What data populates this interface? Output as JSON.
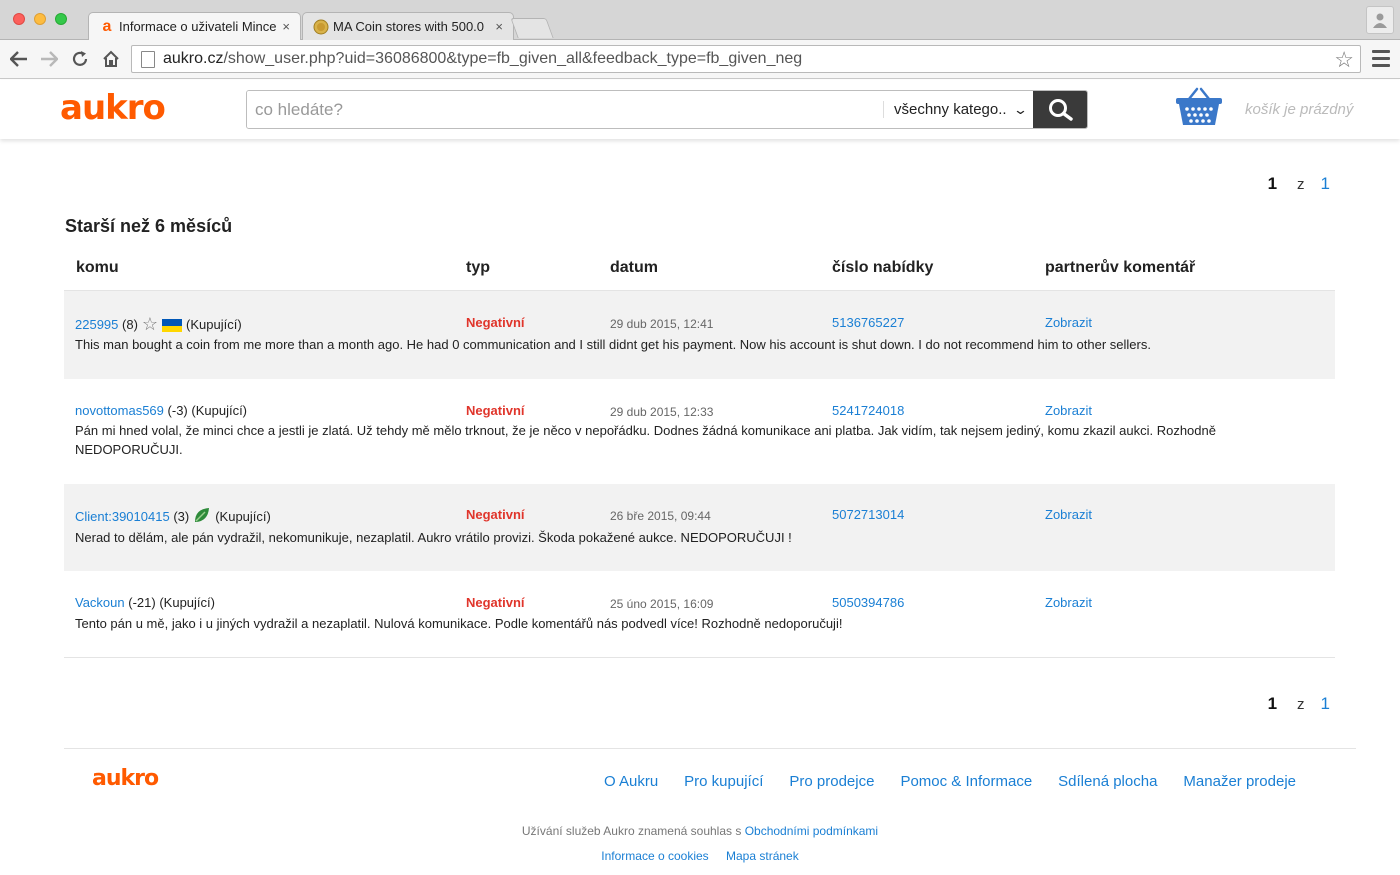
{
  "browser": {
    "tabs": [
      {
        "favicon": "a",
        "title": "Informace o uživateli Mince",
        "close": "×",
        "active": true
      },
      {
        "favicon": "coin",
        "title": "MA Coin stores with 500.0",
        "close": "×",
        "active": false
      }
    ],
    "url_host": "aukro.cz",
    "url_path": "/show_user.php?uid=36086800&type=fb_given_all&feedback_type=fb_given_neg",
    "icons": {
      "back": "back-arrow-icon",
      "forward": "forward-arrow-icon",
      "reload": "reload-icon",
      "home": "home-icon",
      "bookmark": "star-icon",
      "menu": "hamburger-menu-icon",
      "profile": "person-icon"
    }
  },
  "header": {
    "logo": "aukro",
    "search_placeholder": "co hledáte?",
    "category": "všechny katego..",
    "basket_text": "košík je prázdný"
  },
  "pager_top": {
    "current": "1",
    "of": "z",
    "total": "1"
  },
  "section": {
    "title": "Starší než 6 měsíců",
    "columns": {
      "komu": "komu",
      "typ": "typ",
      "datum": "datum",
      "offer": "číslo nabídky",
      "comment": "partnerův komentář"
    }
  },
  "rows": [
    {
      "user": "225995",
      "score": "(8)",
      "badge": "star",
      "flag": "ukraine",
      "role": "(Kupující)",
      "type": "Negativní",
      "date": "29 dub 2015, 12:41",
      "offer": "5136765227",
      "comment_link": "Zobrazit",
      "text": "This man bought a coin from me more than a month ago. He had 0 communication and I still didnt get his payment. Now his account is shut down. I do not recommend him to other sellers."
    },
    {
      "user": "novottomas569",
      "score": "(-3)",
      "badge": "",
      "flag": "",
      "role": "(Kupující)",
      "type": "Negativní",
      "date": "29 dub 2015, 12:33",
      "offer": "5241724018",
      "comment_link": "Zobrazit",
      "text": "Pán mi hned volal, že minci chce a jestli je zlatá. Už tehdy mě mělo trknout, že je něco v nepořádku. Dodnes žádná komunikace ani platba. Jak vidím, tak nejsem jediný, komu zkazil aukci. Rozhodně NEDOPORUČUJI."
    },
    {
      "user": "Client:39010415",
      "score": "(3)",
      "badge": "leaf",
      "flag": "",
      "role": "(Kupující)",
      "type": "Negativní",
      "date": "26 bře 2015, 09:44",
      "offer": "5072713014",
      "comment_link": "Zobrazit",
      "text": "Nerad to dělám, ale pán vydražil, nekomunikuje, nezaplatil. Aukro vrátilo provizi. Škoda pokažené aukce. NEDOPORUČUJI !"
    },
    {
      "user": "Vackoun",
      "score": "(-21)",
      "badge": "",
      "flag": "",
      "role": "(Kupující)",
      "type": "Negativní",
      "date": "25 úno 2015, 16:09",
      "offer": "5050394786",
      "comment_link": "Zobrazit",
      "text": "Tento pán u mě, jako i u jiných vydražil a nezaplatil. Nulová komunikace. Podle komentářů nás podvedl více! Rozhodně nedoporučuji!"
    }
  ],
  "pager_bottom": {
    "current": "1",
    "of": "z",
    "total": "1"
  },
  "footer": {
    "logo": "aukro",
    "nav": [
      "O Aukru",
      "Pro kupující",
      "Pro prodejce",
      "Pomoc & Informace",
      "Sdílená plocha",
      "Manažer prodeje"
    ],
    "terms_prefix": "Užívání služeb Aukro znamená souhlas s ",
    "terms_link": "Obchodními podmínkami",
    "links": [
      "Informace o cookies",
      "Mapa stránek"
    ]
  },
  "colors": {
    "brand": "#ff5a00",
    "link": "#1a7fd4",
    "negative": "#e0352b",
    "row_shade": "#f2f2f2"
  }
}
